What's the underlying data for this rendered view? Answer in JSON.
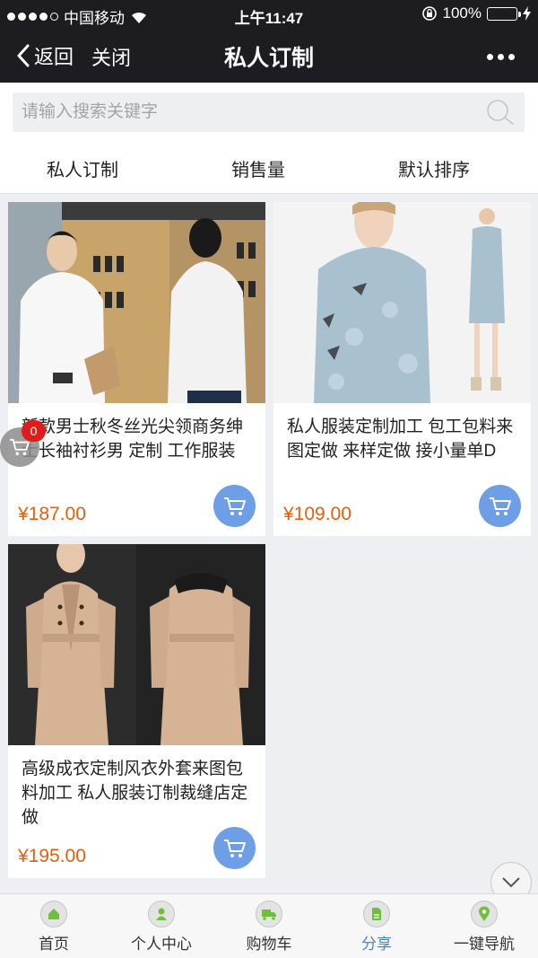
{
  "status_bar": {
    "carrier": "中国移动",
    "time": "上午11:47",
    "battery": "100%"
  },
  "nav": {
    "back_label": "返回",
    "close_label": "关闭",
    "title": "私人订制"
  },
  "search": {
    "placeholder": "请输入搜索关键字"
  },
  "filters": [
    {
      "label": "私人订制"
    },
    {
      "label": "销售量"
    },
    {
      "label": "默认排序"
    }
  ],
  "products": [
    {
      "name": "新款男士秋冬丝光尖领商务绅士长袖衬衫男 定制 工作服装",
      "price": "¥187.00"
    },
    {
      "name": "私人服装定制加工 包工包料来图定做 来样定做 接小量单D",
      "price": "¥109.00"
    },
    {
      "name": "高级成衣定制风衣外套来图包料加工 私人服装订制裁缝店定做",
      "price": "¥195.00"
    }
  ],
  "cart_badge": "0",
  "tabbar": [
    {
      "label": "首页",
      "icon": "home-icon"
    },
    {
      "label": "个人中心",
      "icon": "user-icon"
    },
    {
      "label": "购物车",
      "icon": "truck-icon"
    },
    {
      "label": "分享",
      "icon": "share-icon"
    },
    {
      "label": "一键导航",
      "icon": "location-pin-icon"
    }
  ],
  "colors": {
    "price": "#e5600d",
    "cart_button": "#6e9fe6",
    "active_tab": "#4b82d6",
    "header_bg": "#1d1d21"
  }
}
